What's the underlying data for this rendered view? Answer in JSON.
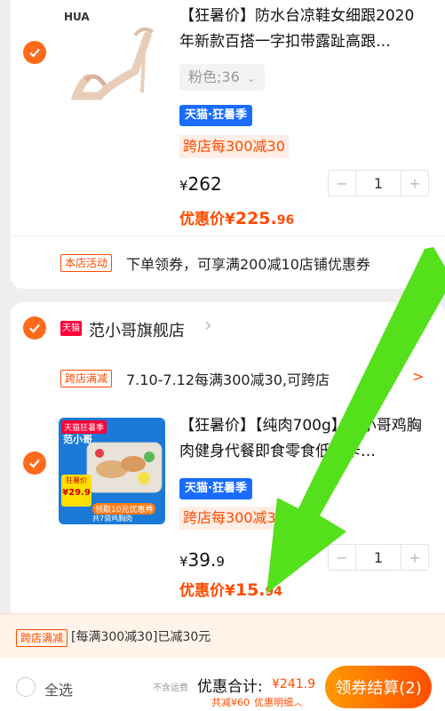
{
  "item1": {
    "title": "【狂暑价】防水台凉鞋女细跟2020年新款百搭一字扣带露趾高跟…",
    "thumb_brand": "HUA",
    "sku": "粉色;36",
    "tmall_tag": "天猫·狂暑季",
    "promo": "跨店每300减30",
    "price_symbol": "¥",
    "price": "262",
    "qty": "1",
    "discount_label": "优惠价",
    "discount_symbol": "¥",
    "discount_int": "225.",
    "discount_dec": "96"
  },
  "store_activity": {
    "tag": "本店活动",
    "text": "下单领券，可享满200减10店铺优惠券"
  },
  "shop2": {
    "icon_text": "天猫",
    "name": "范小哥旗舰店",
    "chevron": "›",
    "right_partial": "领",
    "cross_tag": "跨店满减",
    "cross_text": "7.10-7.12每满300减30,可跨店",
    "cross_chevron": ">"
  },
  "item2": {
    "title": "【狂暑价】【纯肉700g】范小哥鸡胸肉健身代餐即食零食低脂卡…",
    "thumb_tag": "天猫狂暑季",
    "thumb_brand": "范小哥",
    "thumb_badge_top": "狂暑价",
    "thumb_badge_price": "¥29.9",
    "thumb_coupon": "领取10元优惠券",
    "thumb_note": "共7袋鸡胸肉",
    "tmall_tag": "天猫·狂暑季",
    "promo": "跨店每300减30",
    "price_symbol": "¥",
    "price_int": "39.",
    "price_dec": "9",
    "qty": "1",
    "discount_label": "优惠价",
    "discount_symbol": "¥",
    "discount_int": "15.",
    "discount_dec": "94"
  },
  "summary": {
    "tag": "跨店满减",
    "text": "[每满300减30]已减30元"
  },
  "bottom": {
    "select_all": "全选",
    "shipping": "不含运费",
    "total_label": "优惠合计:",
    "total_value": "¥241.9",
    "saved": "共减¥60",
    "detail": "优惠明细",
    "detail_chevron": "︿",
    "checkout": "领券结算(2)"
  },
  "colors": {
    "accent": "#ff4b00",
    "check": "#ff6a1a",
    "overlay_arrow": "#55e01c"
  }
}
